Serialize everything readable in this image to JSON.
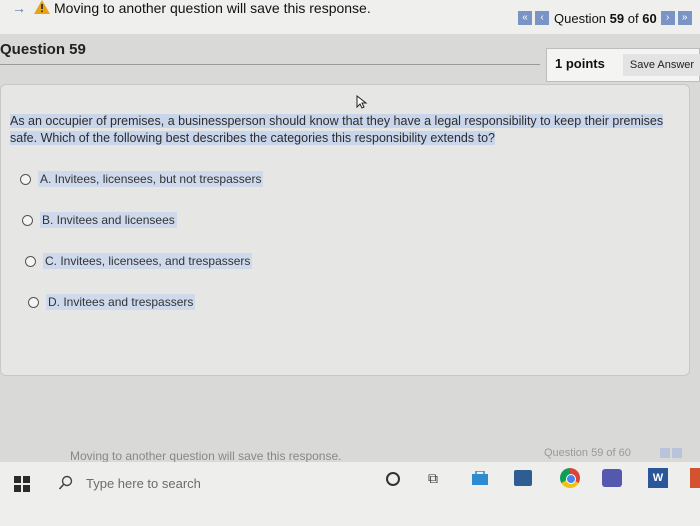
{
  "header": {
    "arrow_glyph": "→",
    "warning_text": "Moving to another question will save this response.",
    "nav": {
      "first_label": "«",
      "prev_label": "‹",
      "question_prefix": "Question",
      "question_number": "59",
      "of_text": "of",
      "total": "60",
      "next_label": "›",
      "last_label": "»"
    }
  },
  "question": {
    "title": "Question 59",
    "points": "1 points",
    "save_label": "Save Answer",
    "text": "As an occupier of premises, a businessperson should know that they have a legal responsibility to keep their premises safe. Which of the following best describes the categories this responsibility extends to?",
    "options": [
      {
        "label": "A. Invitees, licensees, but not trespassers"
      },
      {
        "label": "B. Invitees and licensees"
      },
      {
        "label": "C. Invitees, licensees, and trespassers"
      },
      {
        "label": "D. Invitees and trespassers"
      }
    ]
  },
  "footer": {
    "warning_text": "Moving to another question will save this response.",
    "nav_text": "Question 59 of 60"
  },
  "taskbar": {
    "search_placeholder": "Type here to search",
    "taskview_glyph": "⧉",
    "word_label": "W"
  },
  "colors": {
    "accent": "#7b94c6",
    "highlight": "#c9d5ea",
    "warning": "#e8a317"
  }
}
